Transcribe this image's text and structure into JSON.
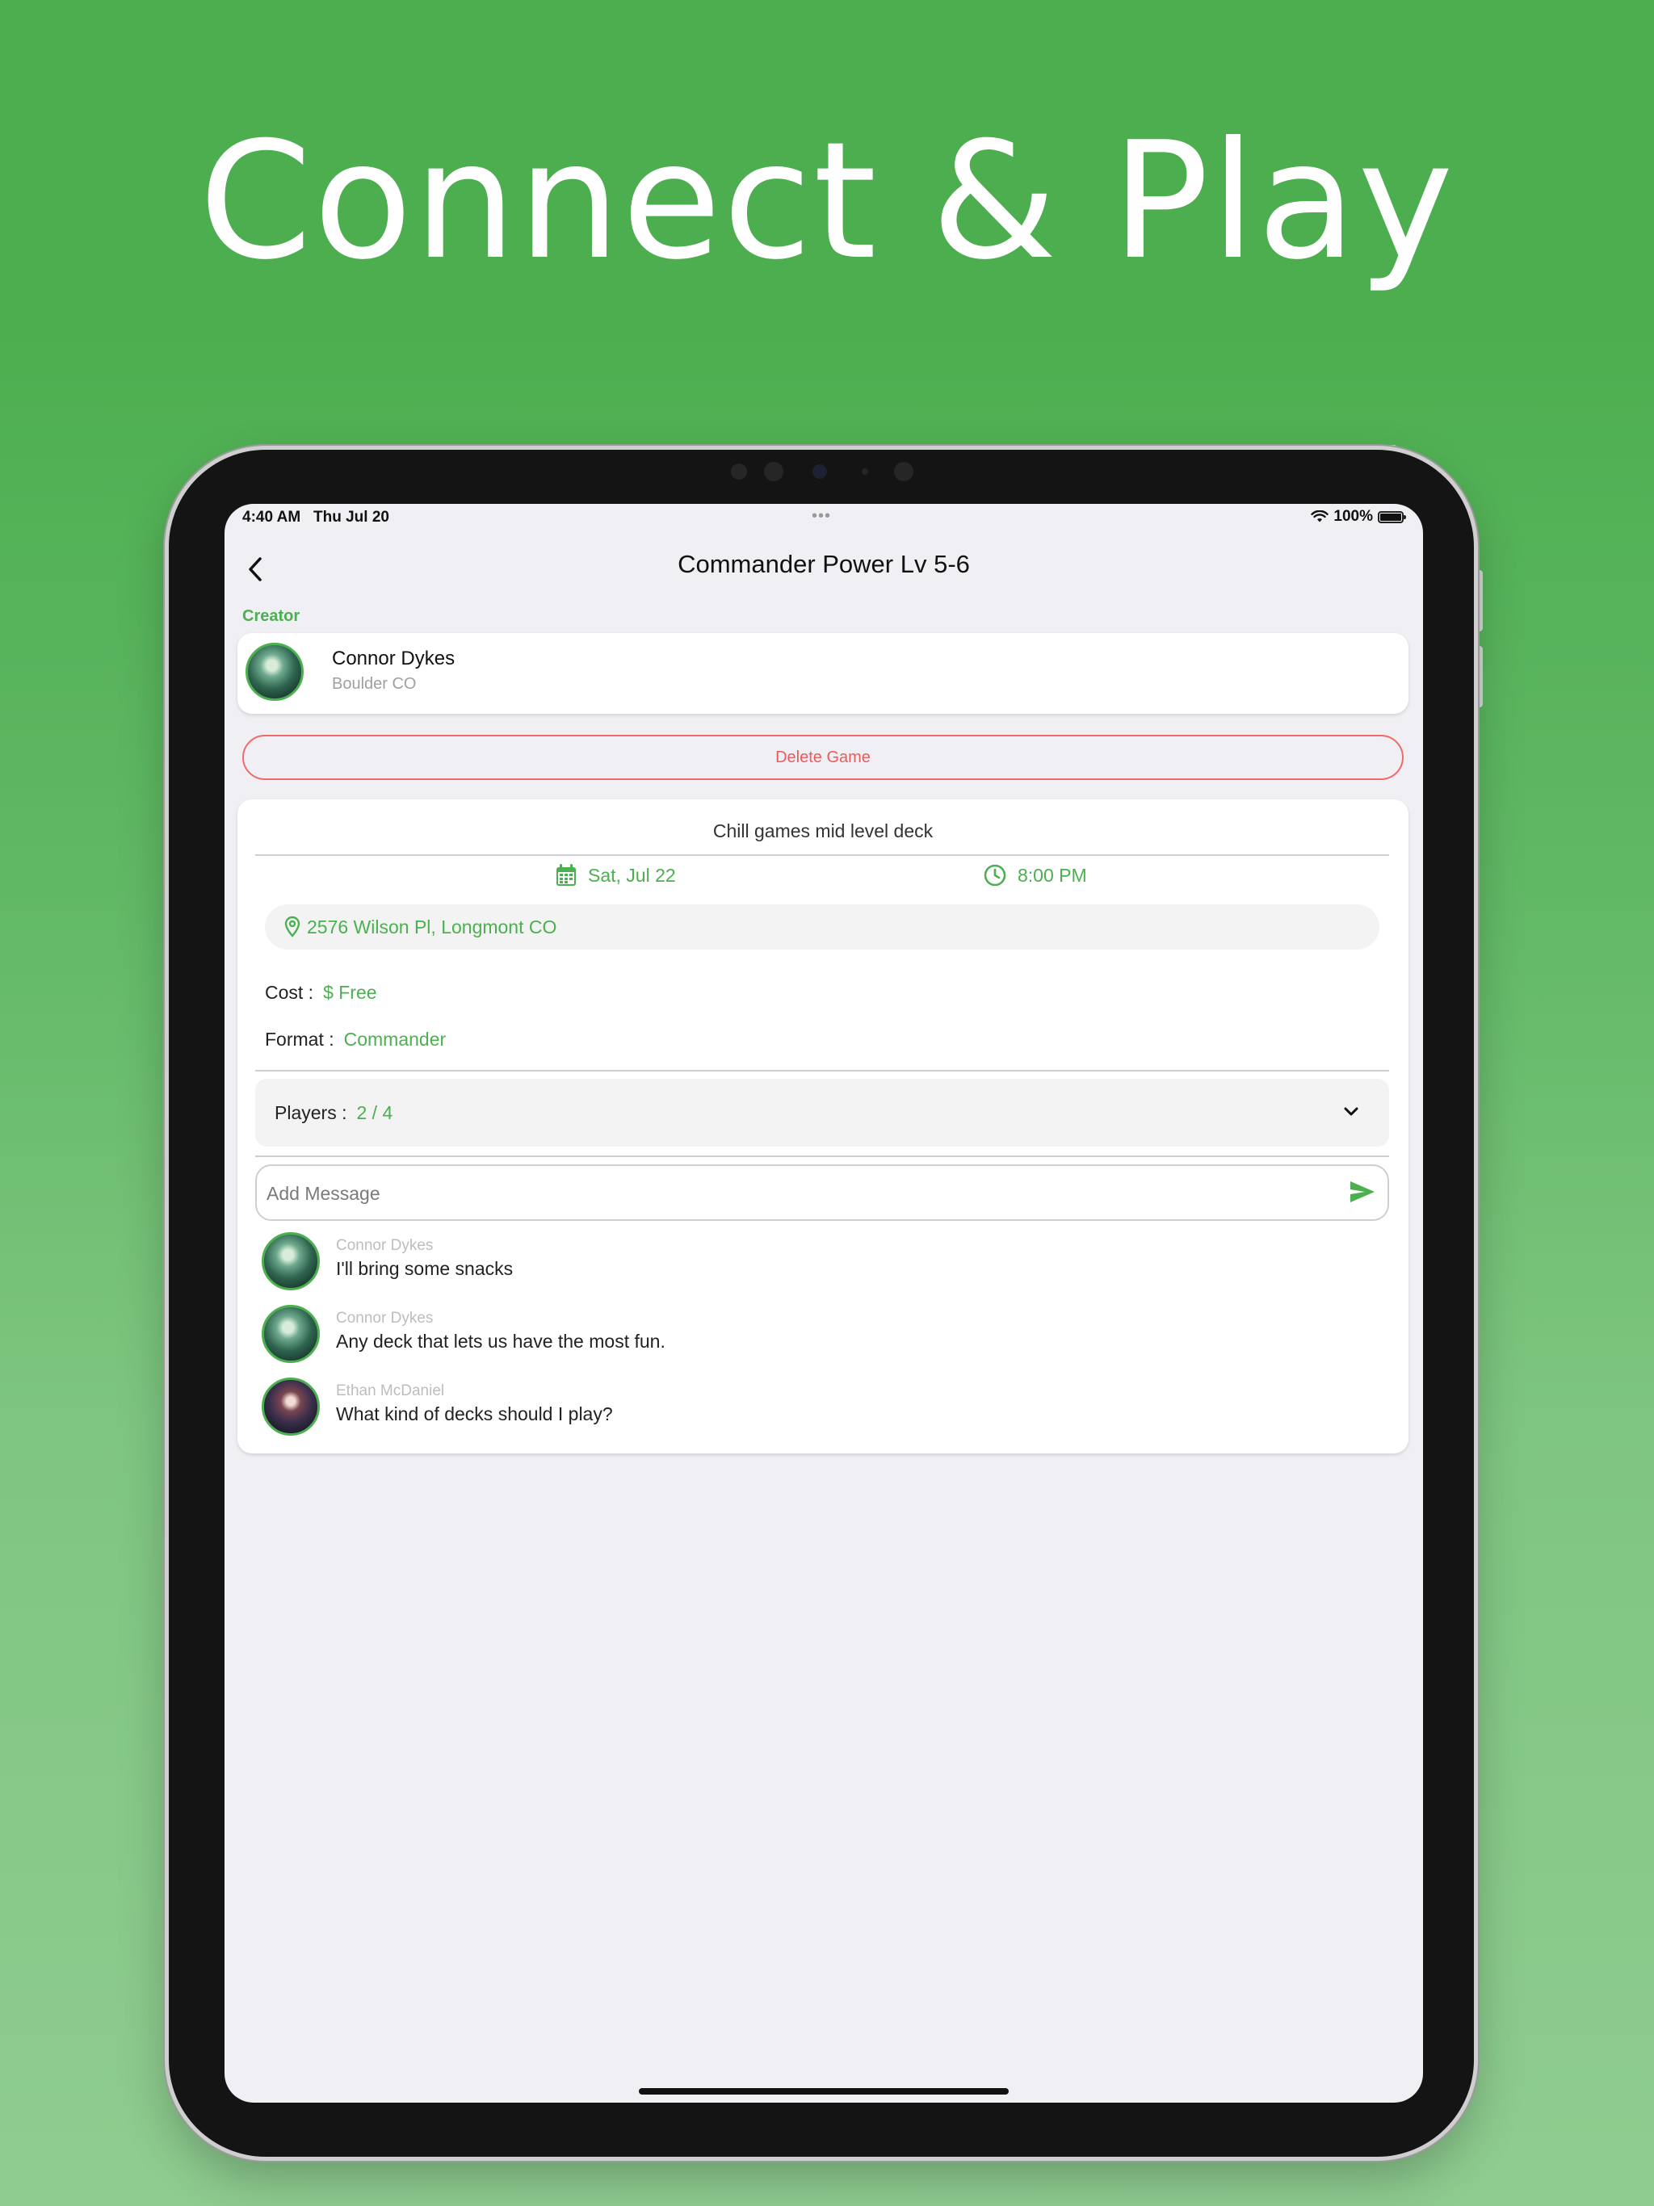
{
  "headline": "Connect & Play",
  "colors": {
    "accent": "#4caf50",
    "danger": "#ec5b5b",
    "screen_bg": "#efeff4"
  },
  "status_bar": {
    "time": "4:40 AM",
    "date": "Thu Jul 20",
    "dots": "•••",
    "battery": "100%"
  },
  "nav": {
    "title": "Commander Power Lv 5-6",
    "back_icon": "chevron-left-icon"
  },
  "creator": {
    "section_label": "Creator",
    "name": "Connor Dykes",
    "location": "Boulder CO"
  },
  "delete_button": "Delete Game",
  "game": {
    "description": "Chill games mid level deck",
    "date": "Sat, Jul 22",
    "time": "8:00 PM",
    "address": "2576 Wilson Pl, Longmont CO",
    "cost_label": "Cost :",
    "cost_value": "$ Free",
    "format_label": "Format :",
    "format_value": "Commander",
    "players_label": "Players :",
    "players_value": "2 / 4"
  },
  "message_input": {
    "placeholder": "Add Message"
  },
  "messages": [
    {
      "author": "Connor Dykes",
      "text": "I'll bring some snacks"
    },
    {
      "author": "Connor Dykes",
      "text": "Any deck that lets us have the most fun."
    },
    {
      "author": "Ethan  McDaniel",
      "text": "What kind of decks should I play?"
    }
  ]
}
